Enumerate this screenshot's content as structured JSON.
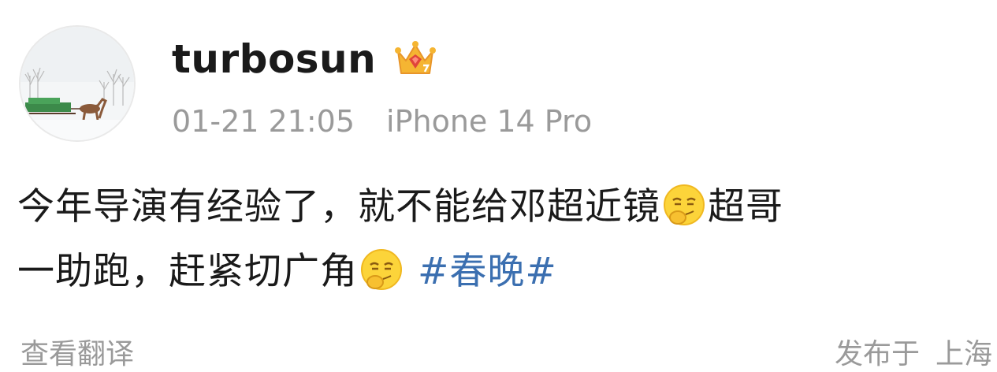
{
  "user": {
    "username": "turbosun",
    "avatar_icon": "avatar-winter-sleigh",
    "badge_icon": "vip-crown-icon"
  },
  "meta": {
    "time": "01-21 21:05",
    "device": "iPhone 14 Pro"
  },
  "post": {
    "text_part1": "今年导演有经验了，就不能给邓超近镜",
    "emoji1": "smirk-emoji-icon",
    "text_part2": "超哥",
    "text_part3": "一助跑，赶紧切广角",
    "emoji2": "smirk-emoji-icon",
    "hashtag": "#春晚#"
  },
  "footer": {
    "translate_label": "查看翻译",
    "published_prefix": "发布于",
    "location": "上海"
  },
  "colors": {
    "text": "#1a1a1a",
    "meta_gray": "#9a9a9a",
    "hashtag_blue": "#3b6fb0",
    "crown_gold": "#f5a623",
    "crown_red": "#e0453a"
  }
}
